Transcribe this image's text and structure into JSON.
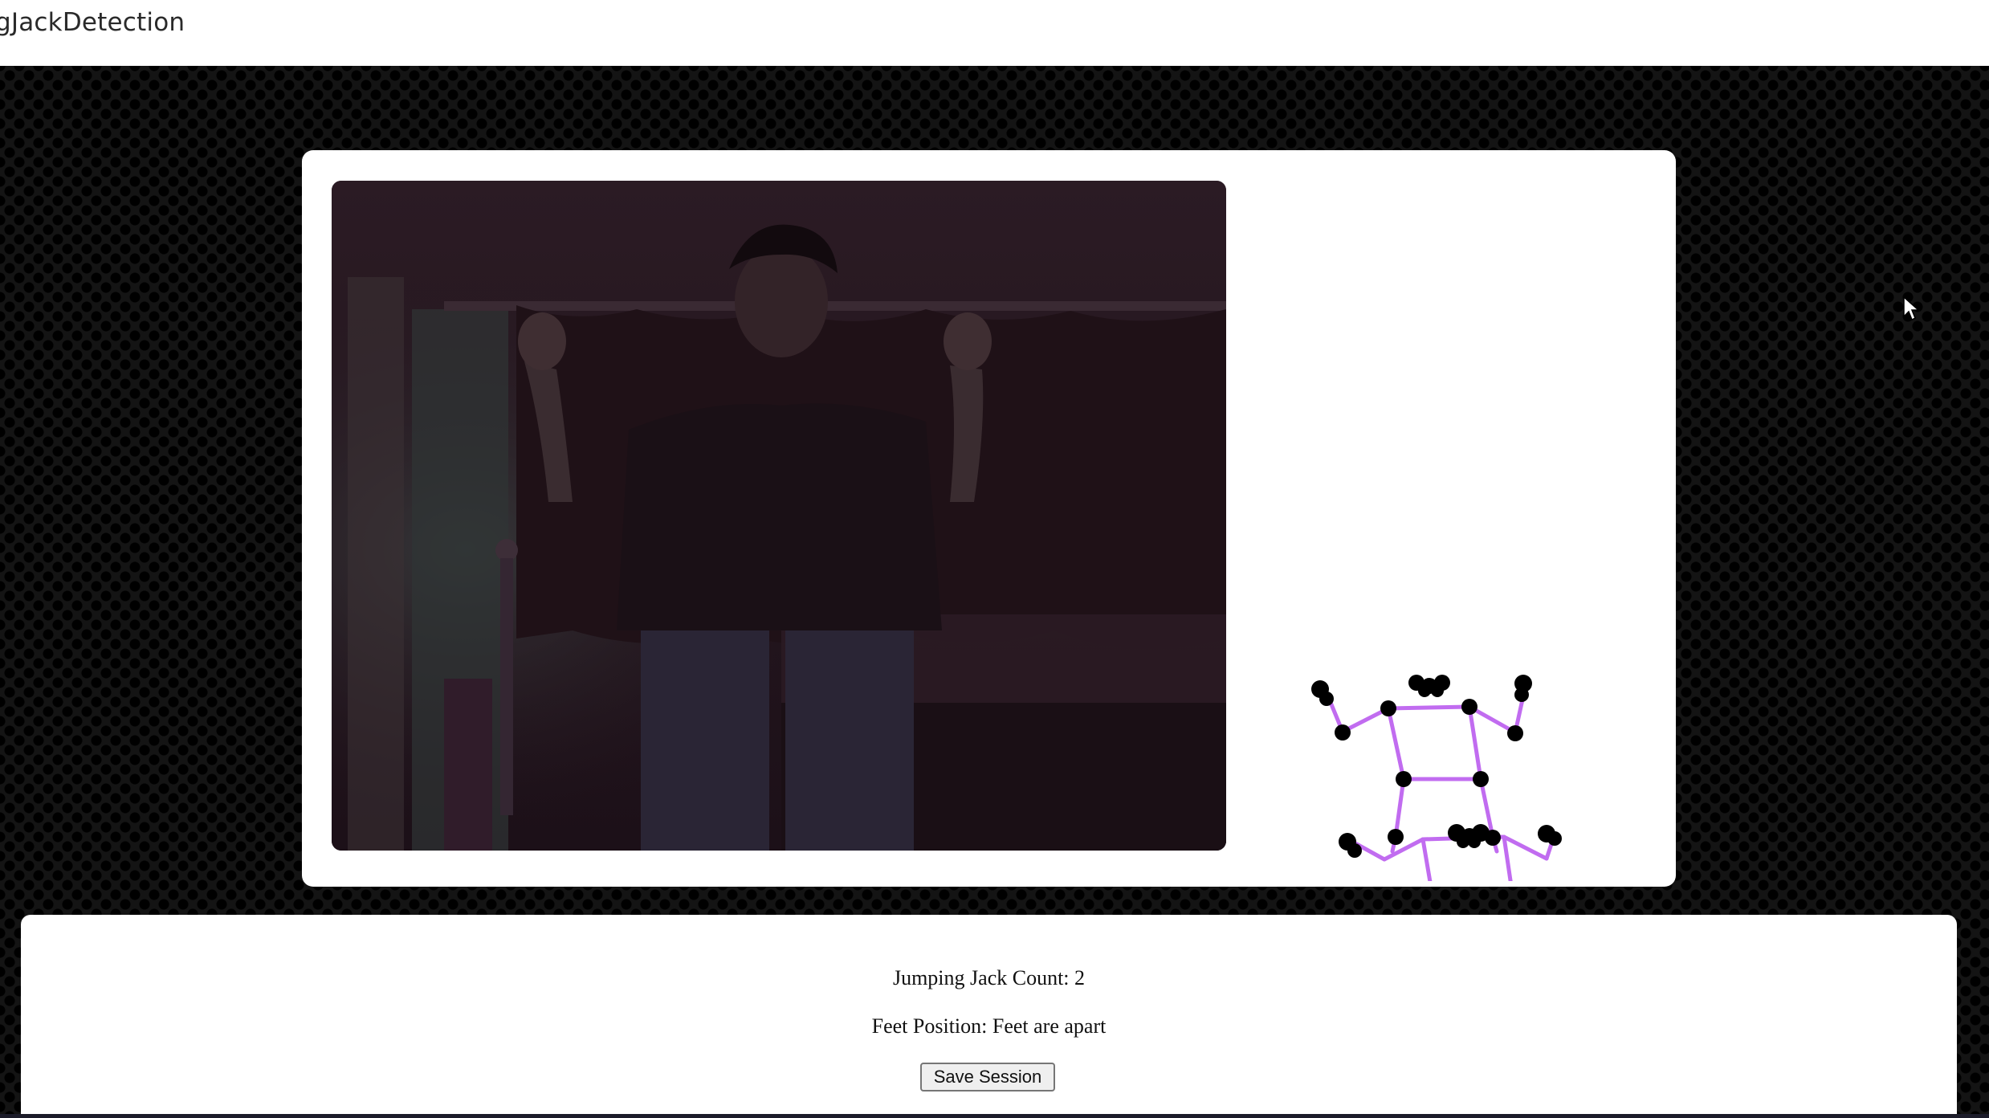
{
  "app": {
    "title": "gJackDetection"
  },
  "viewer": {
    "webcam_feed": "webcam-video",
    "skeleton_color": "#c16cf0",
    "joint_color": "#000000"
  },
  "stats": {
    "count_text": "Jumping Jack Count: 2",
    "feet_text": "Feet Position: Feet are apart",
    "save_label": "Save Session"
  },
  "colors": {
    "backdrop": "#141414",
    "card": "#ffffff"
  }
}
